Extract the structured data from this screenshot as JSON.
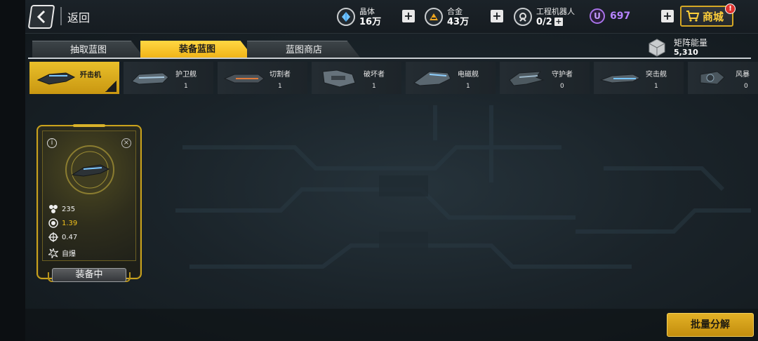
{
  "header": {
    "back_label": "返回",
    "resources": [
      {
        "name": "晶体",
        "value": "16万",
        "icon": "crystal-icon"
      },
      {
        "name": "合金",
        "value": "43万",
        "icon": "alloy-icon"
      },
      {
        "name": "工程机器人",
        "value": "0/2",
        "icon": "robot-icon"
      }
    ],
    "plus": "+",
    "premium_value": "697",
    "premium_icon_letter": "U",
    "shop_label": "商城",
    "shop_badge": "!"
  },
  "tabs": [
    {
      "label": "抽取蓝图",
      "active": false
    },
    {
      "label": "装备蓝图",
      "active": true
    },
    {
      "label": "蓝图商店",
      "active": false
    }
  ],
  "matrix": {
    "label": "矩阵能量",
    "value": "5,310"
  },
  "ships": [
    {
      "name": "歼击机",
      "count": "",
      "selected": true
    },
    {
      "name": "护卫舰",
      "count": "1",
      "selected": false
    },
    {
      "name": "切割者",
      "count": "1",
      "selected": false
    },
    {
      "name": "破坏者",
      "count": "1",
      "selected": false
    },
    {
      "name": "电磁舰",
      "count": "1",
      "selected": false
    },
    {
      "name": "守护者",
      "count": "0",
      "selected": false
    },
    {
      "name": "突击舰",
      "count": "1",
      "selected": false
    },
    {
      "name": "风暴",
      "count": "0",
      "selected": false
    }
  ],
  "card": {
    "info": "i",
    "close": "×",
    "stats": [
      {
        "icon": "cluster-icon",
        "value": "235",
        "highlight": false
      },
      {
        "icon": "target-ring-icon",
        "value": "1.39",
        "highlight": true
      },
      {
        "icon": "crosshair-icon",
        "value": "0.47",
        "highlight": false
      },
      {
        "icon": "explosion-icon",
        "value": "自爆",
        "highlight": false
      }
    ],
    "status_button": "装备中"
  },
  "actions": {
    "bulk_disassemble": "批量分解"
  },
  "colors": {
    "accent": "#f0b316",
    "premium": "#b683ff",
    "alert": "#e0322e"
  }
}
